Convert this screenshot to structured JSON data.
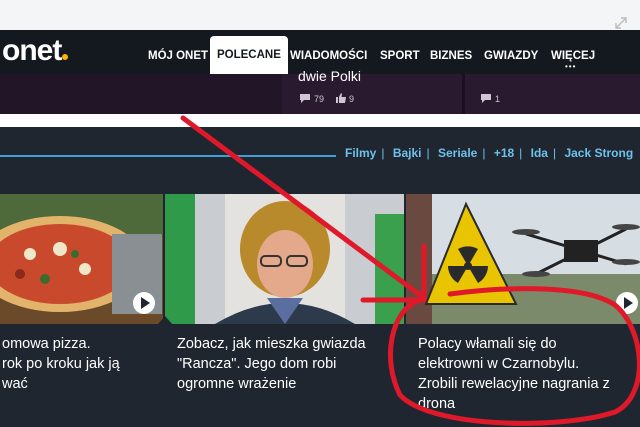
{
  "brand": {
    "logo": "onet",
    "dot_color": "#ffb400"
  },
  "nav": {
    "items": [
      {
        "label": "MÓJ ONET"
      },
      {
        "label": "POLECANE"
      },
      {
        "label": "WIADOMOŚCI"
      },
      {
        "label": "SPORT"
      },
      {
        "label": "BIZNES"
      },
      {
        "label": "GWIAZDY"
      },
      {
        "label": "WIĘCEJ"
      }
    ],
    "active": "POLECANE"
  },
  "teaser": {
    "text": "dwie Polki",
    "comments": "79",
    "likes": "9",
    "right_count": "1"
  },
  "section": {
    "links": [
      "Filmy",
      "Bajki",
      "Seriale",
      "+18",
      "Ida",
      "Jack Strong"
    ],
    "accent": "#3aa0d6"
  },
  "cards": [
    {
      "title_lines": [
        "omowa pizza.",
        "rok po kroku jak ją",
        "wać"
      ]
    },
    {
      "title_lines": [
        "Zobacz, jak mieszka gwiazda",
        "\"Rancza\". Jego dom robi",
        "ogromne wrażenie"
      ]
    },
    {
      "title_lines": [
        "Polacy włamali się do",
        "elektrowni w Czarnobylu.",
        "Zrobili rewelacyjne nagrania z",
        "drona"
      ]
    }
  ],
  "annotation_color": "#e0192a",
  "icons": [
    "expand-icon",
    "comment-icon",
    "like-icon",
    "play-icon",
    "radiation-sign-icon",
    "drone-icon"
  ]
}
